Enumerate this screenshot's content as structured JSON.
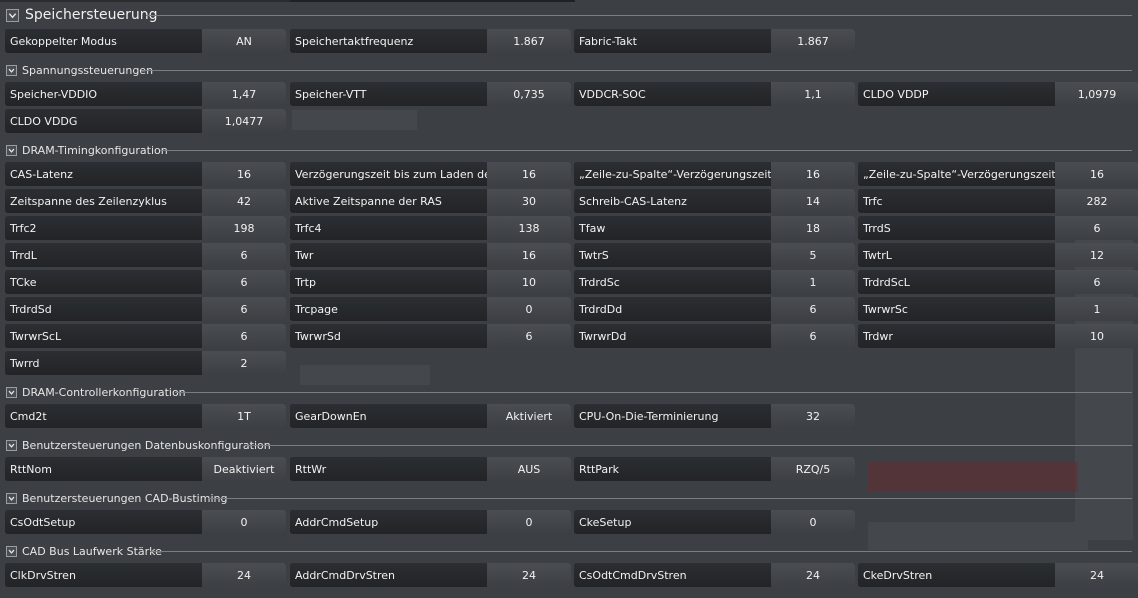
{
  "title": "Speichersteuerung",
  "general": [
    {
      "label": "Gekoppelter Modus",
      "value": "AN"
    },
    {
      "label": "Speichertaktfrequenz",
      "value": "1.867"
    },
    {
      "label": "Fabric-Takt",
      "value": "1.867"
    }
  ],
  "sections": [
    {
      "title": "Spannungssteuerungen",
      "items": [
        {
          "label": "Speicher-VDDIO",
          "value": "1,47"
        },
        {
          "label": "Speicher-VTT",
          "value": "0,735"
        },
        {
          "label": "VDDCR-SOC",
          "value": "1,1"
        },
        {
          "label": "CLDO VDDP",
          "value": "1,0979"
        },
        {
          "label": "CLDO VDDG",
          "value": "1,0477"
        }
      ]
    },
    {
      "title": "DRAM-Timingkonfiguration",
      "items": [
        {
          "label": "CAS-Latenz",
          "value": "16"
        },
        {
          "label": "Verzögerungszeit bis zum Laden der ...",
          "value": "16"
        },
        {
          "label": "„Zeile-zu-Spalte“-Verzögerungszeit f...",
          "value": "16"
        },
        {
          "label": "„Zeile-zu-Spalte“-Verzögerungszeit f...",
          "value": "16"
        },
        {
          "label": "Zeitspanne des Zeilenzyklus",
          "value": "42"
        },
        {
          "label": "Aktive Zeitspanne der RAS",
          "value": "30"
        },
        {
          "label": "Schreib-CAS-Latenz",
          "value": "14"
        },
        {
          "label": "Trfc",
          "value": "282"
        },
        {
          "label": "Trfc2",
          "value": "198"
        },
        {
          "label": "Trfc4",
          "value": "138"
        },
        {
          "label": "Tfaw",
          "value": "18"
        },
        {
          "label": "TrrdS",
          "value": "6"
        },
        {
          "label": "TrrdL",
          "value": "6"
        },
        {
          "label": "Twr",
          "value": "16"
        },
        {
          "label": "TwtrS",
          "value": "5"
        },
        {
          "label": "TwtrL",
          "value": "12"
        },
        {
          "label": "TCke",
          "value": "6"
        },
        {
          "label": "Trtp",
          "value": "10"
        },
        {
          "label": "TrdrdSc",
          "value": "1"
        },
        {
          "label": "TrdrdScL",
          "value": "6"
        },
        {
          "label": "TrdrdSd",
          "value": "6"
        },
        {
          "label": "Trcpage",
          "value": "0"
        },
        {
          "label": "TrdrdDd",
          "value": "6"
        },
        {
          "label": "TwrwrSc",
          "value": "1"
        },
        {
          "label": "TwrwrScL",
          "value": "6"
        },
        {
          "label": "TwrwrSd",
          "value": "6"
        },
        {
          "label": "TwrwrDd",
          "value": "6"
        },
        {
          "label": "Trdwr",
          "value": "10"
        },
        {
          "label": "Twrrd",
          "value": "2"
        }
      ]
    },
    {
      "title": "DRAM-Controllerkonfiguration",
      "items": [
        {
          "label": "Cmd2t",
          "value": "1T"
        },
        {
          "label": "GearDownEn",
          "value": "Aktiviert"
        },
        {
          "label": "CPU-On-Die-Terminierung",
          "value": "32"
        }
      ]
    },
    {
      "title": "Benutzersteuerungen Datenbuskonfiguration",
      "items": [
        {
          "label": "RttNom",
          "value": "Deaktiviert"
        },
        {
          "label": "RttWr",
          "value": "AUS"
        },
        {
          "label": "RttPark",
          "value": "RZQ/5"
        }
      ]
    },
    {
      "title": "Benutzersteuerungen CAD-Bustiming",
      "items": [
        {
          "label": "CsOdtSetup",
          "value": "0"
        },
        {
          "label": "AddrCmdSetup",
          "value": "0"
        },
        {
          "label": "CkeSetup",
          "value": "0"
        }
      ]
    },
    {
      "title": "CAD Bus Laufwerk Stärke",
      "items": [
        {
          "label": "ClkDrvStren",
          "value": "24"
        },
        {
          "label": "AddrCmdDrvStren",
          "value": "24"
        },
        {
          "label": "CsOdtCmdDrvStren",
          "value": "24"
        },
        {
          "label": "CkeDrvStren",
          "value": "24"
        }
      ]
    }
  ]
}
